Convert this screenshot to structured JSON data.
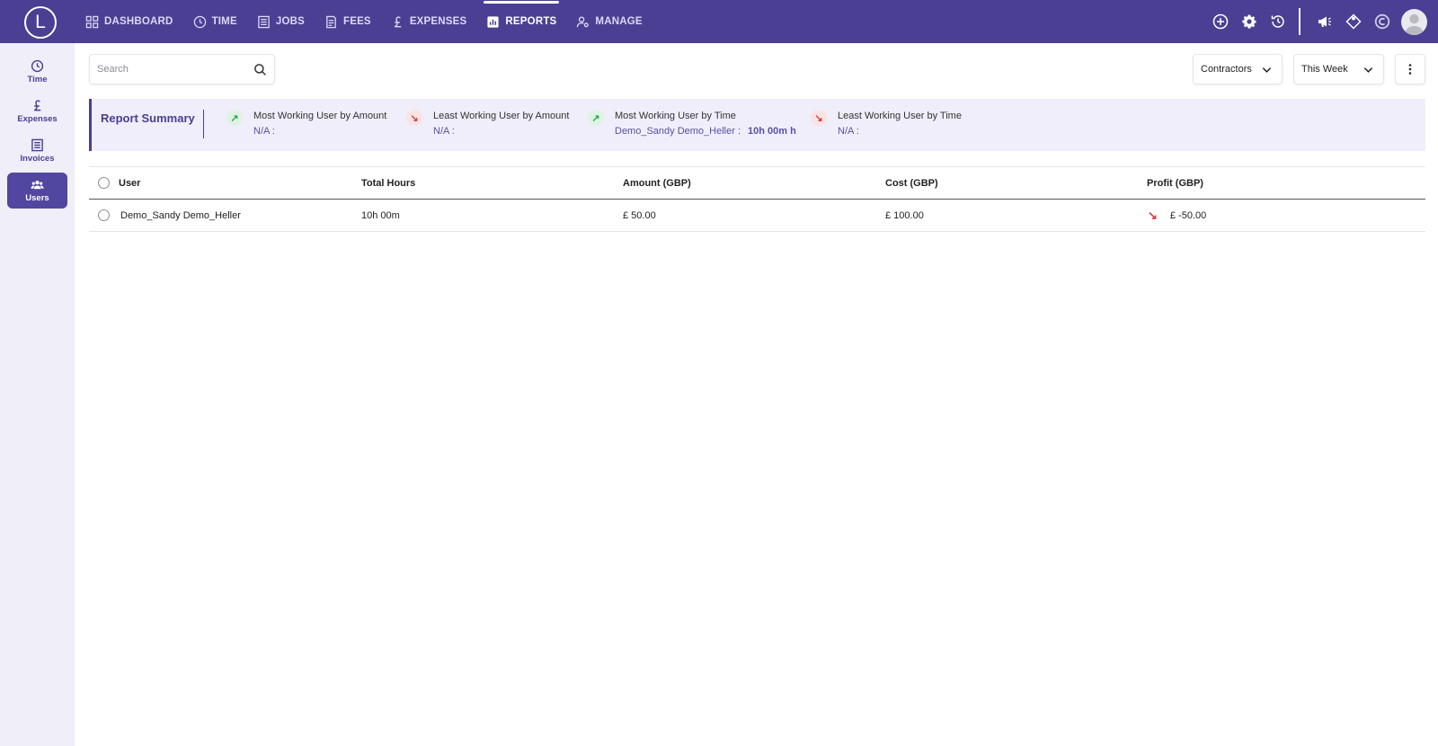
{
  "logo": {
    "letter": "L"
  },
  "nav": {
    "items": [
      {
        "label": "DASHBOARD",
        "icon": "grid-icon"
      },
      {
        "label": "TIME",
        "icon": "clock-icon"
      },
      {
        "label": "JOBS",
        "icon": "list-icon"
      },
      {
        "label": "FEES",
        "icon": "document-icon"
      },
      {
        "label": "EXPENSES",
        "icon": "pound-icon"
      },
      {
        "label": "REPORTS",
        "icon": "bar-chart-icon",
        "active": true
      },
      {
        "label": "MANAGE",
        "icon": "user-gear-icon"
      }
    ]
  },
  "top_icons": [
    "add-circle-icon",
    "settings-icon",
    "history-icon",
    "megaphone-icon",
    "tag-icon",
    "c-logo-icon",
    "avatar"
  ],
  "sidebar": {
    "items": [
      {
        "label": "Time",
        "icon": "clock-icon"
      },
      {
        "label": "Expenses",
        "icon": "pound-icon"
      },
      {
        "label": "Invoices",
        "icon": "invoice-icon"
      },
      {
        "label": "Users",
        "icon": "users-icon",
        "active": true
      }
    ]
  },
  "search": {
    "placeholder": "Search",
    "value": ""
  },
  "filters": {
    "group": "Contractors",
    "period": "This Week"
  },
  "summary": {
    "title": "Report Summary",
    "metrics": [
      {
        "label": "Most Working User by Amount",
        "value": "N/A :",
        "extra": "",
        "trend": "up"
      },
      {
        "label": "Least Working User by Amount",
        "value": "N/A :",
        "extra": "",
        "trend": "down"
      },
      {
        "label": "Most Working User by Time",
        "value": "Demo_Sandy Demo_Heller :",
        "extra": "10h 00m h",
        "trend": "up"
      },
      {
        "label": "Least Working User by Time",
        "value": "N/A :",
        "extra": "",
        "trend": "down"
      }
    ]
  },
  "table": {
    "columns": [
      "User",
      "Total Hours",
      "Amount (GBP)",
      "Cost (GBP)",
      "Profit (GBP)"
    ],
    "rows": [
      {
        "user": "Demo_Sandy Demo_Heller",
        "hours": "10h 00m",
        "amount": "£ 50.00",
        "cost": "£ 100.00",
        "profit": "£ -50.00",
        "profit_trend": "down"
      }
    ]
  },
  "colors": {
    "brand": "#4a3f93",
    "summary_bg": "#efeefa",
    "positive": "#2aa84a",
    "negative": "#d93a3a"
  }
}
